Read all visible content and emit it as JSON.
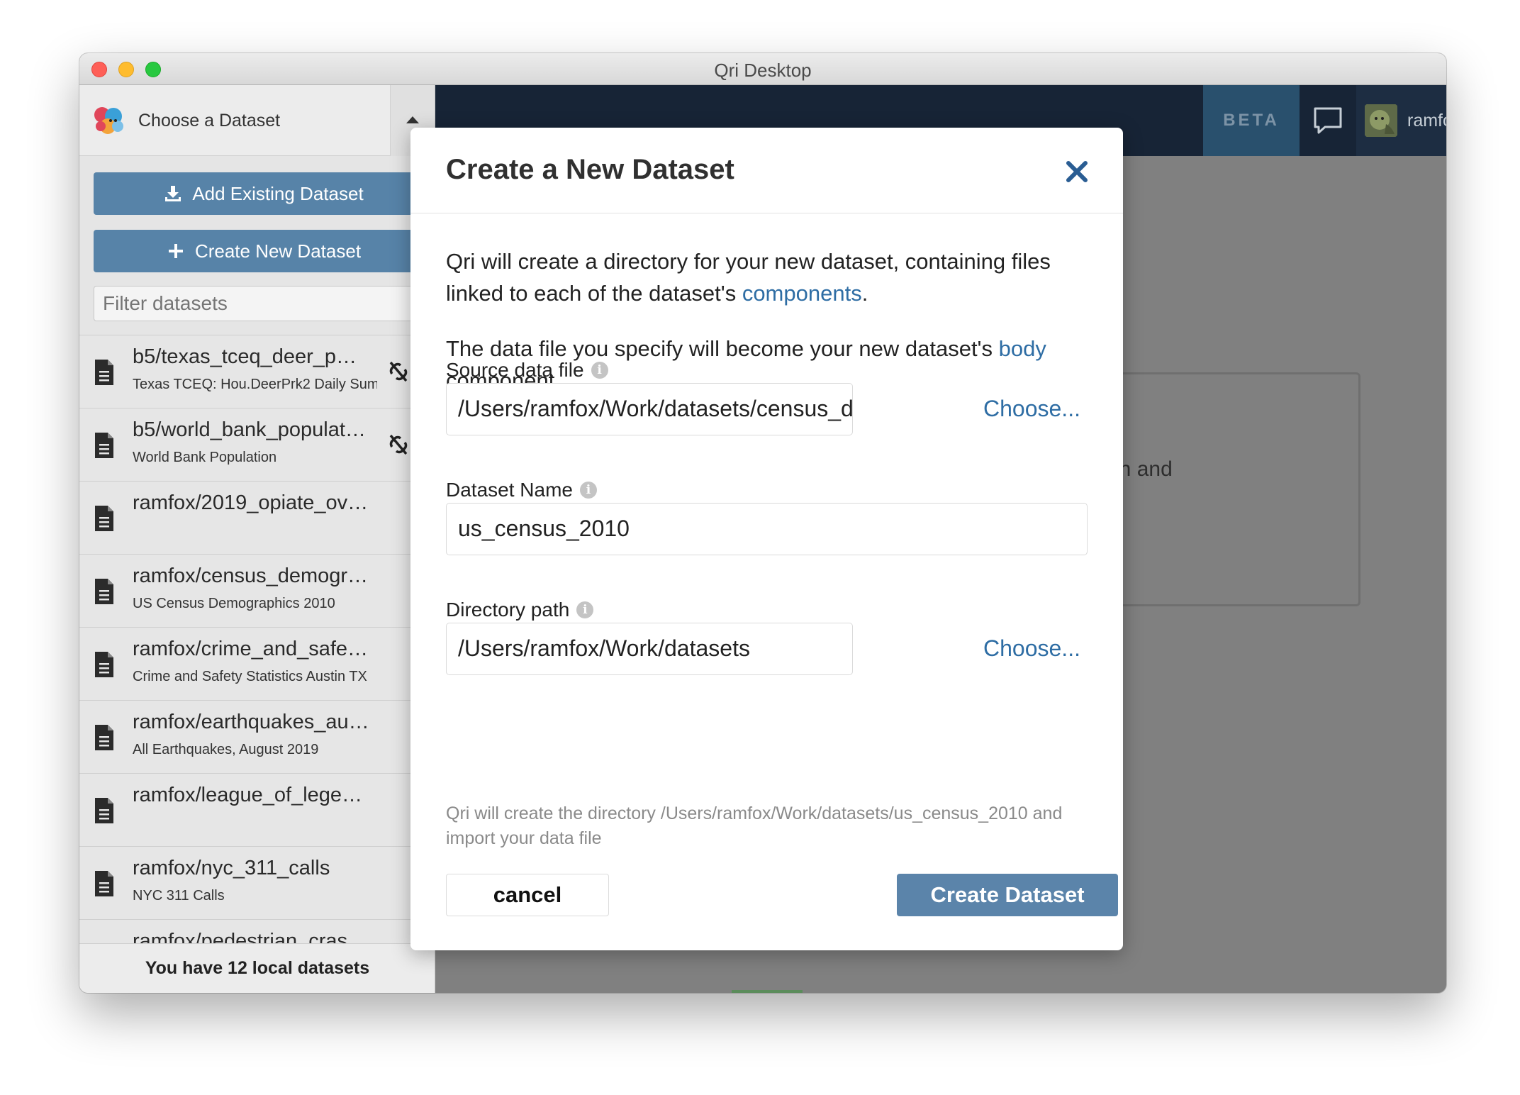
{
  "window": {
    "title": "Qri Desktop"
  },
  "sidebar": {
    "chooser_label": "Choose a Dataset",
    "add_existing_label": "Add Existing Dataset",
    "create_new_label": "Create New Dataset",
    "filter_placeholder": "Filter datasets",
    "datasets": [
      {
        "title": "b5/texas_tceq_deer_p…",
        "subtitle": "Texas TCEQ: Hou.DeerPrk2 Daily Sum",
        "unlinked": true
      },
      {
        "title": "b5/world_bank_populat…",
        "subtitle": "World Bank Population",
        "unlinked": true
      },
      {
        "title": "ramfox/2019_opiate_ov…",
        "subtitle": "",
        "unlinked": false
      },
      {
        "title": "ramfox/census_demogr…",
        "subtitle": "US Census Demographics 2010",
        "unlinked": false
      },
      {
        "title": "ramfox/crime_and_safe…",
        "subtitle": "Crime and Safety Statistics Austin TX",
        "unlinked": false
      },
      {
        "title": "ramfox/earthquakes_au…",
        "subtitle": "All Earthquakes, August 2019",
        "unlinked": false
      },
      {
        "title": "ramfox/league_of_lege…",
        "subtitle": "",
        "unlinked": false
      },
      {
        "title": "ramfox/nyc_311_calls",
        "subtitle": "NYC 311 Calls",
        "unlinked": false
      },
      {
        "title": "ramfox/pedestrian_cras…",
        "subtitle": "",
        "unlinked": false
      }
    ],
    "footer": "You have 12 local datasets"
  },
  "header": {
    "beta_label": "BETA",
    "username": "ramfox"
  },
  "background_text": "en and",
  "modal": {
    "title": "Create a New Dataset",
    "para1_pre": "Qri will create a directory for your new dataset, containing files linked to each of the dataset's ",
    "para1_link": "components",
    "para1_post": ".",
    "para2_pre": "The data file you specify will become your new dataset's ",
    "para2_link": "body",
    "para2_post": " component.",
    "source_label": "Source data file",
    "source_value": "/Users/ramfox/Work/datasets/census_demog",
    "name_label": "Dataset Name",
    "name_value": "us_census_2010",
    "dir_label": "Directory path",
    "dir_value": "/Users/ramfox/Work/datasets",
    "choose_label": "Choose...",
    "hint": "Qri will create the directory /Users/ramfox/Work/datasets/us_census_2010 and import your data file",
    "cancel_label": "cancel",
    "create_label": "Create Dataset"
  },
  "colors": {
    "primary_button": "#5783a8",
    "header_bg": "#172436",
    "link": "#2e6da4",
    "close_icon": "#2a5d93"
  }
}
